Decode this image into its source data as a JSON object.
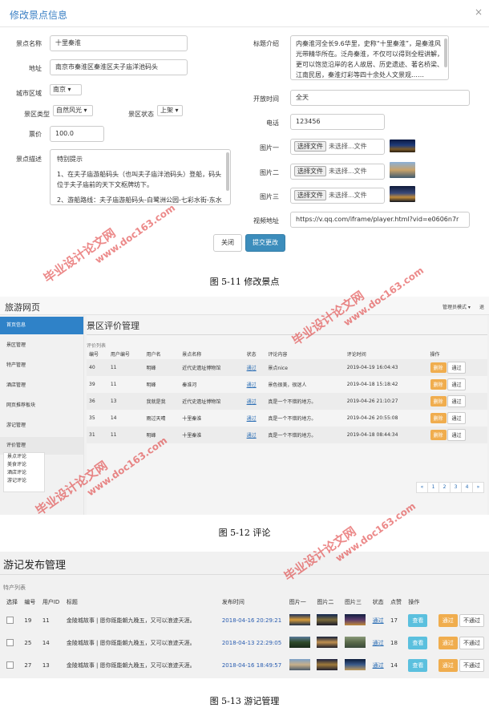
{
  "fig1": {
    "title": "修改景点信息",
    "close": "×",
    "fields": {
      "name_label": "景点名称",
      "name_value": "十里秦淮",
      "address_label": "地址",
      "address_value": "南京市秦淮区秦淮区夫子庙洋池码头",
      "city_label": "城市区域",
      "city_value": "南京",
      "type_label": "景区类型",
      "type_value": "自然风光",
      "status_label": "景区状态",
      "status_value": "上架",
      "price_label": "票价",
      "price_value": "100.0",
      "desc_label": "景点描述",
      "desc_lines": [
        "特别提示",
        "1、在夫子庙游船码头（也叫夫子庙泮池码头）登船，码头位于夫子庙前的天下文枢牌坊下。",
        "2、游船路线：夫子庙游船码头-白鹭洲公园-七彩水街-东水关-中华门-夫子庙游船码头。晚上坐船的游客会比较多，建议提前订票……"
      ],
      "intro_label": "标题介绍",
      "intro_text": "内秦淮河全长9.6华里，史称“十里秦淮”，是秦淮风光带精华所在。泛舟秦淮，不仅可以得到全程讲解，更可以饱览沿岸的名人故居、历史遗迹、著名桥梁、江南民居，秦淮灯彩等四十余处人文景观……",
      "open_label": "开放时间",
      "open_value": "全天",
      "phone_label": "电话",
      "phone_value": "123456",
      "pic1_label": "图片一",
      "pic2_label": "图片二",
      "pic3_label": "图片三",
      "file_btn": "选择文件",
      "file_none": "未选择...文件",
      "video_label": "视频地址",
      "video_value": "https://v.qq.com/iframe/player.html?vid=e0606n7r"
    },
    "btn_close": "关闭",
    "btn_submit": "提交更改"
  },
  "caption1": "图 5-11  修改景点",
  "fig2": {
    "brand": "旅游网页",
    "topright": [
      "管理员模式 ▾",
      "退"
    ],
    "sidebar": [
      "首页信息",
      "景区管理",
      "特产管理",
      "酒店管理",
      "网页推荐板块",
      "游记管理",
      "评价管理"
    ],
    "submenu": [
      "景点评论",
      "美食评论",
      "酒店评论",
      "游记评论"
    ],
    "panel_title": "景区评价管理",
    "sub_title": "评价列表",
    "headers": [
      "编号",
      "用户编号",
      "用户名",
      "景点名称",
      "状态",
      "评论内容",
      "评论时间",
      "操作"
    ],
    "rows": [
      [
        "40",
        "11",
        "明峰",
        "近代史遗址博物馆",
        "通过",
        "景点nice",
        "2019-04-19 16:04:43"
      ],
      [
        "39",
        "11",
        "明峰",
        "秦淮河",
        "通过",
        "景色很美，很迷人",
        "2019-04-18 15:18:42"
      ],
      [
        "36",
        "13",
        "我就是我",
        "近代史遗址博物馆",
        "通过",
        "真是一个不错的地方。",
        "2019-04-26 21:10:27"
      ],
      [
        "35",
        "14",
        "雨过天晴",
        "十里秦淮",
        "通过",
        "真是一个不错的地方。",
        "2019-04-26 20:55:08"
      ],
      [
        "31",
        "11",
        "明峰",
        "十里秦淮",
        "通过",
        "真是一个不错的地方。",
        "2019-04-18 08:44:34"
      ]
    ],
    "btn_del": "删除",
    "btn_pass": "通过",
    "pager": [
      "«",
      "1",
      "2",
      "3",
      "4",
      "»"
    ]
  },
  "caption2": "图 5-12  评论",
  "fig3": {
    "title": "游记发布管理",
    "sub_title": "特产列表",
    "headers": [
      "选择",
      "编号",
      "用户ID",
      "标题",
      "发布时间",
      "图片一",
      "图片二",
      "图片三",
      "状态",
      "点赞",
      "操作"
    ],
    "rows": [
      [
        "19",
        "11",
        "金陵城故事 | 愿你既能朝九晚五，又可以浪迹天涯。",
        "2018-04-16 20:29:21",
        "通过",
        "17"
      ],
      [
        "25",
        "14",
        "金陵城故事 | 愿你既能朝九晚五，又可以浪迹天涯。",
        "2018-04-13 22:29:05",
        "通过",
        "18"
      ],
      [
        "27",
        "13",
        "金陵城故事 | 愿你既能朝九晚五，又可以浪迹天涯。",
        "2018-04-16 18:49:57",
        "通过",
        "14"
      ]
    ],
    "btn_view": "查看",
    "btn_pass": "通过",
    "btn_fail": "不通过"
  },
  "caption3": "图 5-13  游记管理",
  "watermark": {
    "a": "毕业设计论文网",
    "b": "www.doc163.com"
  }
}
